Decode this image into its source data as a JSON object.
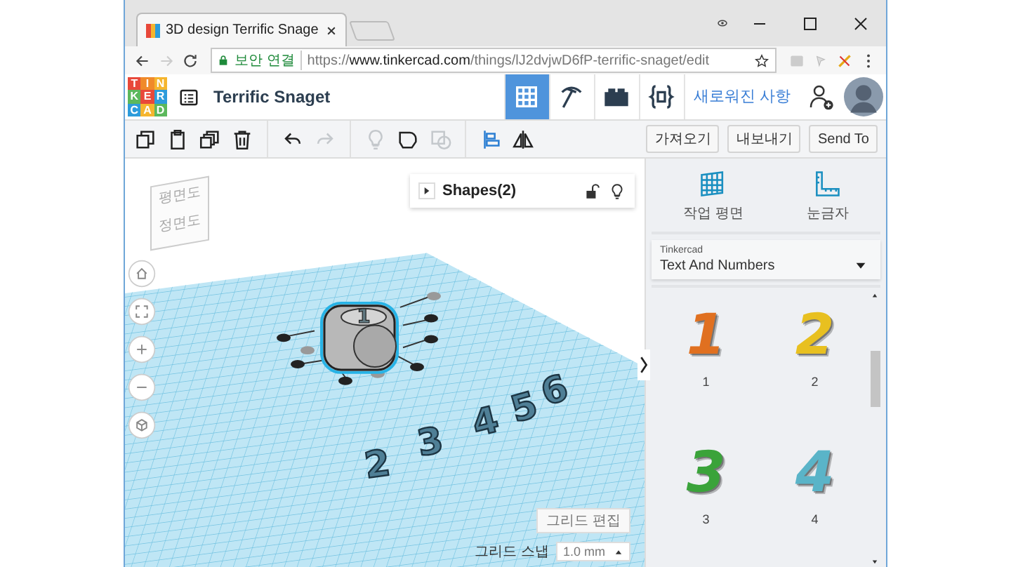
{
  "browser": {
    "tab_title": "3D design Terrific Snage",
    "security_label": "보안 연결",
    "url_scheme": "https://",
    "url_host": "www.tinkercad.com",
    "url_path": "/things/lJ2dvjwD6fP-terrific-snaget/edit",
    "forward_disabled": true
  },
  "header": {
    "logo": [
      {
        "letter": "T",
        "color": "#e8483a"
      },
      {
        "letter": "I",
        "color": "#f08a2a"
      },
      {
        "letter": "N",
        "color": "#f5b52e"
      },
      {
        "letter": "K",
        "color": "#5cb85c"
      },
      {
        "letter": "E",
        "color": "#e8483a"
      },
      {
        "letter": "R",
        "color": "#2d9cdb"
      },
      {
        "letter": "C",
        "color": "#2d9cdb"
      },
      {
        "letter": "A",
        "color": "#f5b52e"
      },
      {
        "letter": "D",
        "color": "#5cb85c"
      }
    ],
    "design_title": "Terrific Snaget",
    "view_tabs": [
      {
        "kind": "grid",
        "selected": true
      },
      {
        "kind": "pickaxe",
        "selected": false
      },
      {
        "kind": "brick",
        "selected": false
      },
      {
        "kind": "code",
        "selected": false
      }
    ],
    "whats_new": "새로워진 사항"
  },
  "toolbar": {
    "tools": [
      {
        "kind": "copy",
        "disabled": false
      },
      {
        "kind": "paste",
        "disabled": false
      },
      {
        "kind": "duplicate",
        "disabled": false
      },
      {
        "kind": "delete",
        "disabled": false
      },
      {
        "kind": "undo",
        "disabled": false
      },
      {
        "kind": "redo",
        "disabled": true
      },
      {
        "kind": "bulb",
        "disabled": true
      },
      {
        "kind": "group",
        "disabled": false
      },
      {
        "kind": "hole",
        "disabled": true
      },
      {
        "kind": "align",
        "disabled": false
      },
      {
        "kind": "mirror",
        "disabled": false
      }
    ],
    "buttons": [
      "가져오기",
      "내보내기",
      "Send To"
    ]
  },
  "viewport": {
    "view_cube": [
      "평면도",
      "정면도"
    ],
    "shapes_panel": {
      "title": "Shapes(2)"
    },
    "dice_label": "1",
    "scene_numbers": [
      "2",
      "3",
      "4",
      "5",
      "6"
    ],
    "edit_grid": "그리드 편집",
    "snap_label": "그리드 스냅",
    "snap_value": "1.0 mm"
  },
  "sidebar": {
    "tools": [
      {
        "kind": "workplane",
        "label": "작업 평면"
      },
      {
        "kind": "ruler",
        "label": "눈금자"
      }
    ],
    "library_source": "Tinkercad",
    "library_name": "Text And Numbers",
    "shapes": [
      {
        "glyph": "1",
        "label": "1",
        "color": "#e07020"
      },
      {
        "glyph": "2",
        "label": "2",
        "color": "#e8c020"
      },
      {
        "glyph": "3",
        "label": "3",
        "color": "#3aa33a"
      },
      {
        "glyph": "4",
        "label": "4",
        "color": "#5ab4c8"
      }
    ]
  }
}
